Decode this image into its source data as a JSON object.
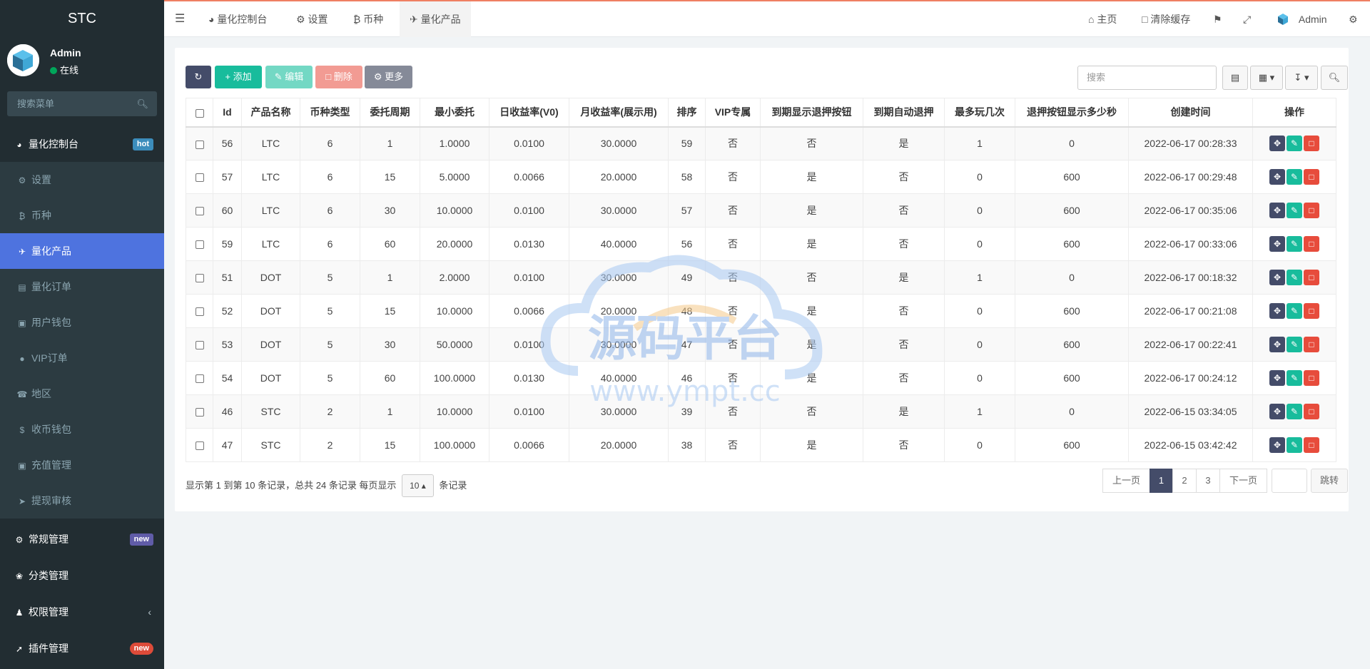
{
  "app": {
    "logo": "STC"
  },
  "user": {
    "name": "Admin",
    "status": "在线"
  },
  "sidebar": {
    "search_placeholder": "搜索菜单",
    "dashboard": {
      "label": "量化控制台",
      "badge": "hot"
    },
    "items": [
      {
        "label": "设置",
        "icon": "gear-icon"
      },
      {
        "label": "币种",
        "icon": "bitcoin-icon"
      },
      {
        "label": "量化产品",
        "icon": "plane-icon"
      },
      {
        "label": "量化订单",
        "icon": "book-icon"
      },
      {
        "label": "用户钱包",
        "icon": "money-icon"
      },
      {
        "label": "VIP订单",
        "icon": "vip-icon"
      },
      {
        "label": "地区",
        "icon": "phone-icon"
      },
      {
        "label": "收币钱包",
        "icon": "dollar-icon"
      },
      {
        "label": "充值管理",
        "icon": "money-icon"
      },
      {
        "label": "提现审核",
        "icon": "circle-arrow-icon"
      }
    ],
    "groups": [
      {
        "label": "常规管理",
        "badge": "new"
      },
      {
        "label": "分类管理"
      },
      {
        "label": "权限管理"
      },
      {
        "label": "插件管理",
        "badge": "new"
      }
    ]
  },
  "topbar": {
    "tabs": [
      "量化控制台",
      "设置",
      "币种",
      "量化产品"
    ],
    "home": "主页",
    "clear_cache": "清除缓存",
    "user": "Admin"
  },
  "toolbar": {
    "add": "添加",
    "edit": "编辑",
    "delete": "删除",
    "more": "更多",
    "search_placeholder": "搜索"
  },
  "table": {
    "headers": [
      "Id",
      "产品名称",
      "币种类型",
      "委托周期",
      "最小委托",
      "日收益率(V0)",
      "月收益率(展示用)",
      "排序",
      "VIP专属",
      "到期显示退押按钮",
      "到期自动退押",
      "最多玩几次",
      "退押按钮显示多少秒",
      "创建时间",
      "操作"
    ],
    "rows": [
      [
        "56",
        "LTC",
        "6",
        "1",
        "1.0000",
        "0.0100",
        "30.0000",
        "59",
        "否",
        "否",
        "是",
        "1",
        "0",
        "2022-06-17 00:28:33"
      ],
      [
        "57",
        "LTC",
        "6",
        "15",
        "5.0000",
        "0.0066",
        "20.0000",
        "58",
        "否",
        "是",
        "否",
        "0",
        "600",
        "2022-06-17 00:29:48"
      ],
      [
        "60",
        "LTC",
        "6",
        "30",
        "10.0000",
        "0.0100",
        "30.0000",
        "57",
        "否",
        "是",
        "否",
        "0",
        "600",
        "2022-06-17 00:35:06"
      ],
      [
        "59",
        "LTC",
        "6",
        "60",
        "20.0000",
        "0.0130",
        "40.0000",
        "56",
        "否",
        "是",
        "否",
        "0",
        "600",
        "2022-06-17 00:33:06"
      ],
      [
        "51",
        "DOT",
        "5",
        "1",
        "2.0000",
        "0.0100",
        "30.0000",
        "49",
        "否",
        "否",
        "是",
        "1",
        "0",
        "2022-06-17 00:18:32"
      ],
      [
        "52",
        "DOT",
        "5",
        "15",
        "10.0000",
        "0.0066",
        "20.0000",
        "48",
        "否",
        "是",
        "否",
        "0",
        "600",
        "2022-06-17 00:21:08"
      ],
      [
        "53",
        "DOT",
        "5",
        "30",
        "50.0000",
        "0.0100",
        "30.0000",
        "47",
        "否",
        "是",
        "否",
        "0",
        "600",
        "2022-06-17 00:22:41"
      ],
      [
        "54",
        "DOT",
        "5",
        "60",
        "100.0000",
        "0.0130",
        "40.0000",
        "46",
        "否",
        "是",
        "否",
        "0",
        "600",
        "2022-06-17 00:24:12"
      ],
      [
        "46",
        "STC",
        "2",
        "1",
        "10.0000",
        "0.0100",
        "30.0000",
        "39",
        "否",
        "否",
        "是",
        "1",
        "0",
        "2022-06-15 03:34:05"
      ],
      [
        "47",
        "STC",
        "2",
        "15",
        "100.0000",
        "0.0066",
        "20.0000",
        "38",
        "否",
        "是",
        "否",
        "0",
        "600",
        "2022-06-15 03:42:42"
      ]
    ]
  },
  "pagination": {
    "info": "显示第 1 到第 10 条记录，总共 24 条记录 每页显示",
    "page_size": "10",
    "suffix": "条记录",
    "prev": "上一页",
    "pages": [
      "1",
      "2",
      "3"
    ],
    "next": "下一页",
    "jump": "跳转"
  },
  "watermark": {
    "title": "源码平台",
    "url": "www.ympt.cc"
  },
  "colors": {
    "sidebar": "#222d32",
    "active": "#4e73df",
    "primary": "#18bc9c",
    "danger": "#e74c3c",
    "dark": "#444c69"
  }
}
